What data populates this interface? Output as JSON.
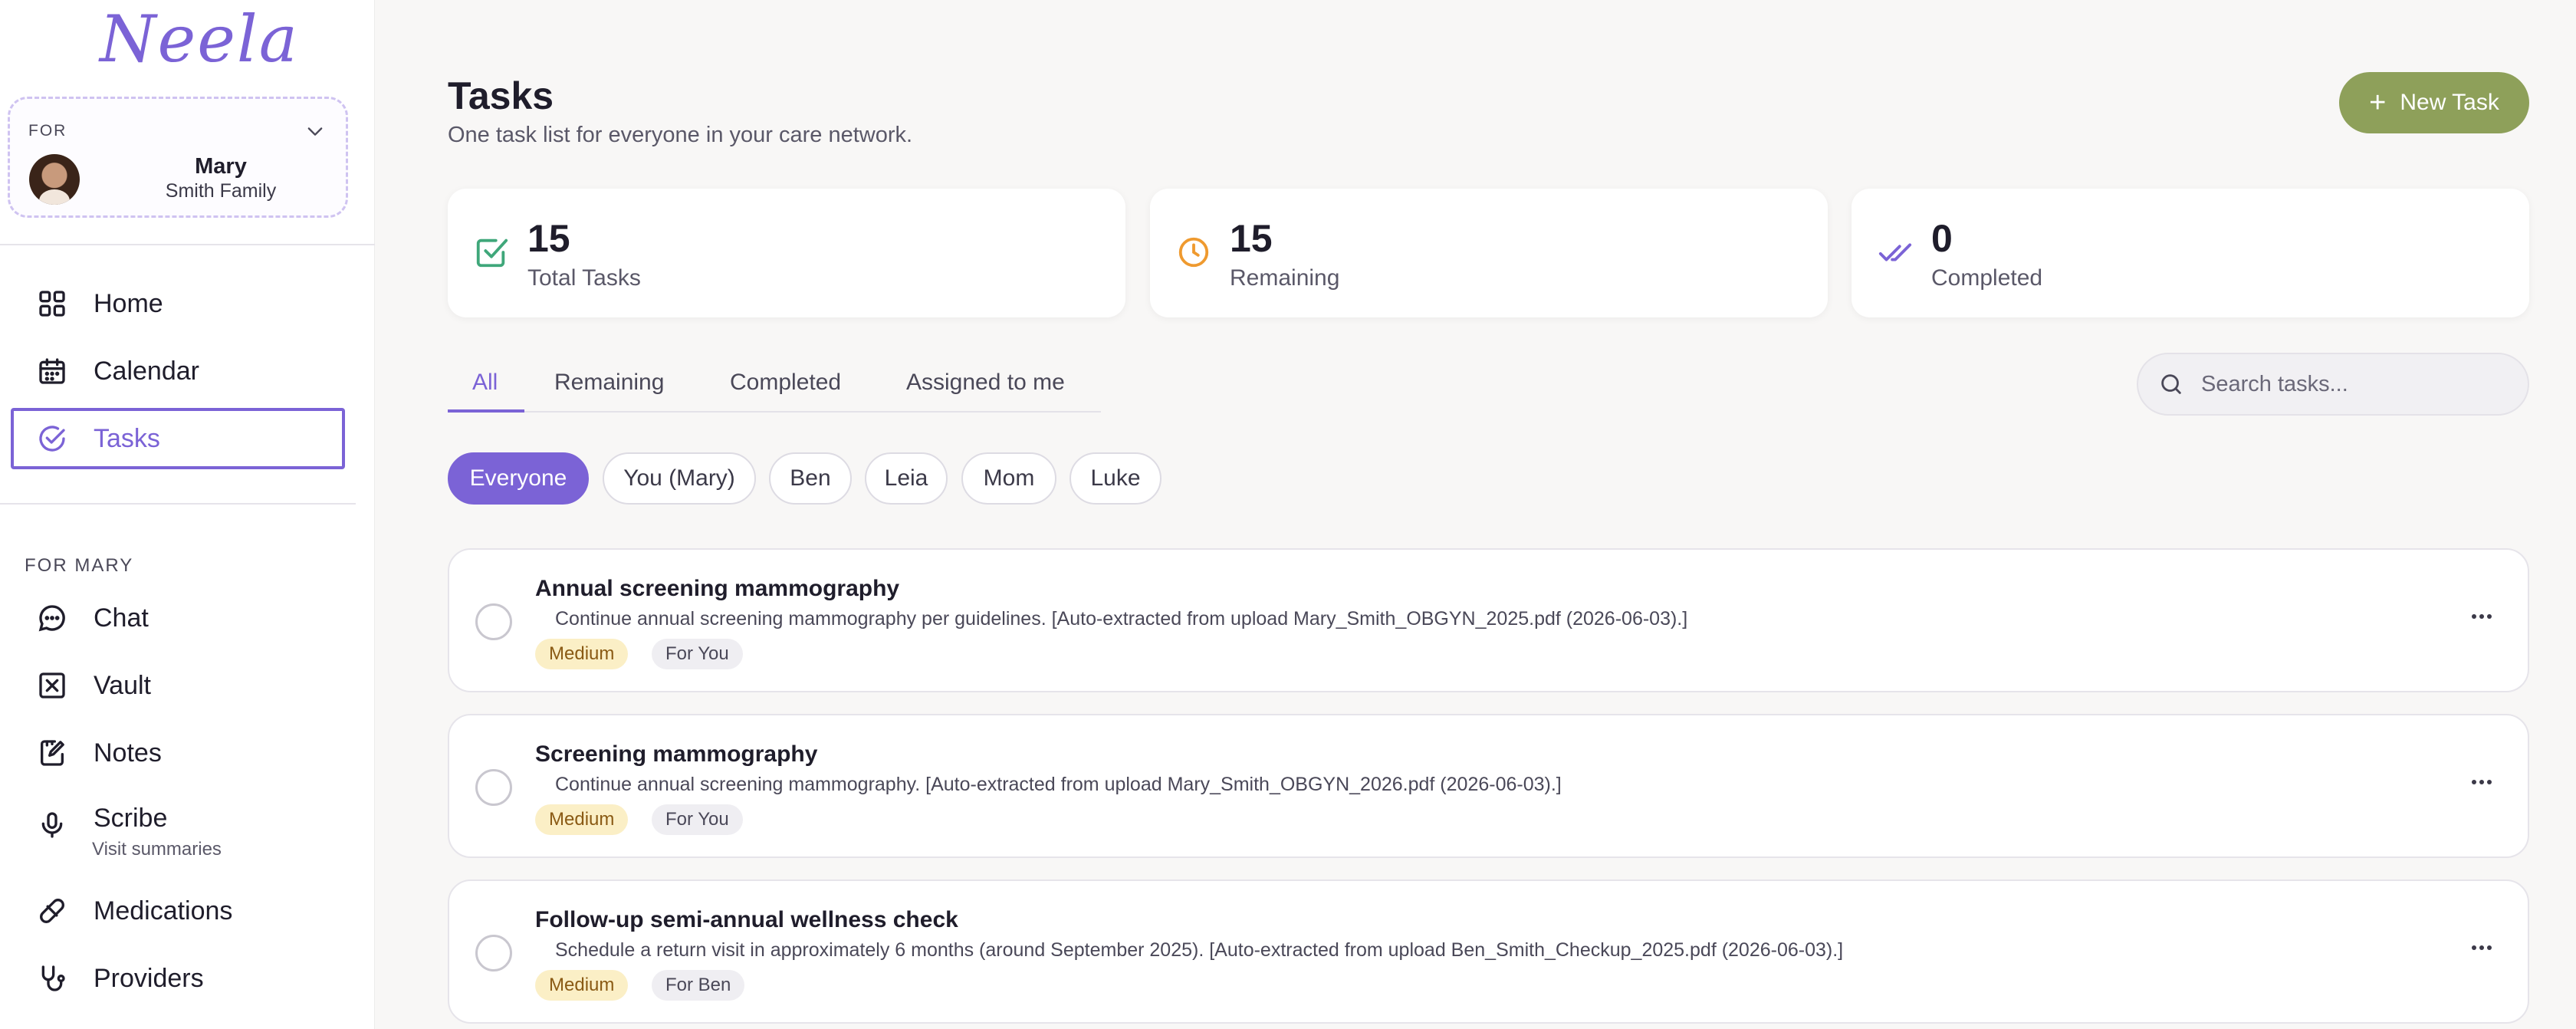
{
  "sidebar": {
    "logo": "Neela",
    "profile": {
      "for_label": "FOR",
      "name": "Mary",
      "family": "Smith Family"
    },
    "nav_primary": [
      {
        "label": "Home",
        "icon": "grid-icon"
      },
      {
        "label": "Calendar",
        "icon": "calendar-icon"
      },
      {
        "label": "Tasks",
        "icon": "check-circle-icon",
        "active": true
      }
    ],
    "section_label": "FOR MARY",
    "nav_secondary": [
      {
        "label": "Chat",
        "icon": "chat-bubble-icon"
      },
      {
        "label": "Vault",
        "icon": "vault-icon"
      },
      {
        "label": "Notes",
        "icon": "notes-icon"
      },
      {
        "label": "Scribe",
        "sub": "Visit summaries",
        "icon": "microphone-icon"
      },
      {
        "label": "Medications",
        "icon": "pill-icon"
      },
      {
        "label": "Providers",
        "icon": "stethoscope-icon"
      }
    ]
  },
  "header": {
    "title": "Tasks",
    "subtitle": "One task list for everyone in your care network.",
    "new_task_label": "New Task"
  },
  "stats": [
    {
      "value": "15",
      "label": "Total Tasks",
      "icon": "checkbox-icon",
      "color": "#3fa77a"
    },
    {
      "value": "15",
      "label": "Remaining",
      "icon": "clock-icon",
      "color": "#ef9a2f"
    },
    {
      "value": "0",
      "label": "Completed",
      "icon": "double-check-icon",
      "color": "#7b63d6"
    }
  ],
  "tabs": [
    "All",
    "Remaining",
    "Completed",
    "Assigned to me"
  ],
  "active_tab": "All",
  "search": {
    "placeholder": "Search tasks..."
  },
  "filters": [
    "Everyone",
    "You (Mary)",
    "Ben",
    "Leia",
    "Mom",
    "Luke"
  ],
  "active_filter": "Everyone",
  "tasks": [
    {
      "title": "Annual screening mammography",
      "description": "Continue annual screening mammography per guidelines. [Auto-extracted from upload Mary_Smith_OBGYN_2025.pdf (2026-06-03).]",
      "priority": "Medium",
      "assignee": "For You"
    },
    {
      "title": "Screening mammography",
      "description": "Continue annual screening mammography. [Auto-extracted from upload Mary_Smith_OBGYN_2026.pdf (2026-06-03).]",
      "priority": "Medium",
      "assignee": "For You"
    },
    {
      "title": "Follow-up semi-annual wellness check",
      "description": "Schedule a return visit in approximately 6 months (around September 2025). [Auto-extracted from upload Ben_Smith_Checkup_2025.pdf (2026-06-03).]",
      "priority": "Medium",
      "assignee": "For Ben"
    }
  ],
  "colors": {
    "accent": "#7b63d6",
    "new_task_button": "#8ea05a",
    "priority_medium_bg": "#fbefc6"
  }
}
